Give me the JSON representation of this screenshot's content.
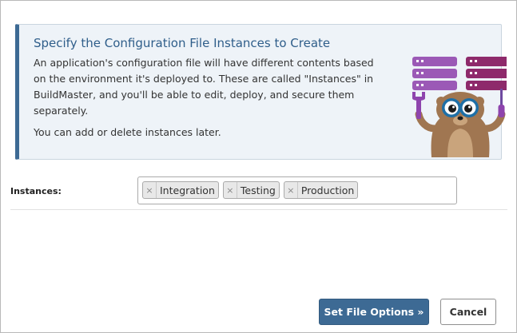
{
  "info": {
    "title": "Specify the Configuration File Instances to Create",
    "paragraph1": "An application's configuration file will have different contents based on the environment it's deployed to. These are called \"Instances\" in BuildMaster, and you'll be able to edit, deploy, and secure them separately.",
    "paragraph2": "You can add or delete instances later.",
    "illustration": "mascot-with-servers-illustration"
  },
  "instances": {
    "label": "Instances:",
    "tags": [
      {
        "label": "Integration",
        "remove_glyph": "×"
      },
      {
        "label": "Testing",
        "remove_glyph": "×"
      },
      {
        "label": "Production",
        "remove_glyph": "×"
      }
    ]
  },
  "buttons": {
    "primary": "Set File Options »",
    "secondary": "Cancel"
  },
  "colors": {
    "accent": "#3d6a94",
    "info_background": "#eef3f8",
    "server_light": "#9b59b6",
    "server_dark": "#8e2a6b"
  }
}
